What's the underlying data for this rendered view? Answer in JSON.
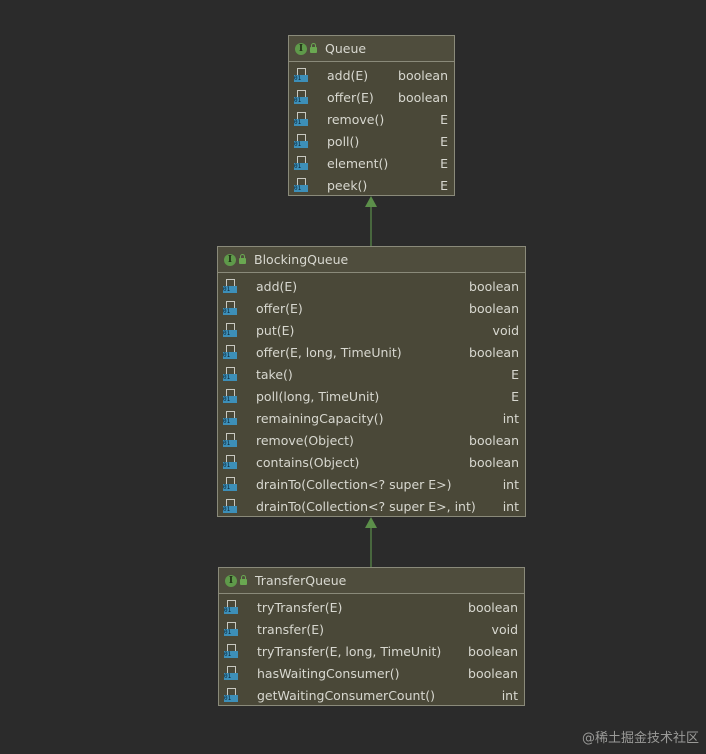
{
  "boxes": [
    {
      "title": "Queue",
      "methods": [
        {
          "name": "add(E)",
          "type": "boolean"
        },
        {
          "name": "offer(E)",
          "type": "boolean"
        },
        {
          "name": "remove()",
          "type": "E"
        },
        {
          "name": "poll()",
          "type": "E"
        },
        {
          "name": "element()",
          "type": "E"
        },
        {
          "name": "peek()",
          "type": "E"
        }
      ]
    },
    {
      "title": "BlockingQueue",
      "methods": [
        {
          "name": "add(E)",
          "type": "boolean"
        },
        {
          "name": "offer(E)",
          "type": "boolean"
        },
        {
          "name": "put(E)",
          "type": "void"
        },
        {
          "name": "offer(E, long, TimeUnit)",
          "type": "boolean"
        },
        {
          "name": "take()",
          "type": "E"
        },
        {
          "name": "poll(long, TimeUnit)",
          "type": "E"
        },
        {
          "name": "remainingCapacity()",
          "type": "int"
        },
        {
          "name": "remove(Object)",
          "type": "boolean"
        },
        {
          "name": "contains(Object)",
          "type": "boolean"
        },
        {
          "name": "drainTo(Collection<? super E>)",
          "type": "int"
        },
        {
          "name": "drainTo(Collection<? super E>, int)",
          "type": "int"
        }
      ]
    },
    {
      "title": "TransferQueue",
      "methods": [
        {
          "name": "tryTransfer(E)",
          "type": "boolean"
        },
        {
          "name": "transfer(E)",
          "type": "void"
        },
        {
          "name": "tryTransfer(E, long, TimeUnit)",
          "type": "boolean"
        },
        {
          "name": "hasWaitingConsumer()",
          "type": "boolean"
        },
        {
          "name": "getWaitingConsumerCount()",
          "type": "int"
        }
      ]
    }
  ],
  "icon_labels": {
    "interface": "I",
    "method_bits": "01"
  },
  "watermark": "@稀土掘金技术社区",
  "colors": {
    "background": "#2b2b2b",
    "box_fill": "#4a4838",
    "arrow": "#5c8f4a",
    "interface_icon": "#5f9a4a",
    "method_icon": "#3d8fb8"
  }
}
